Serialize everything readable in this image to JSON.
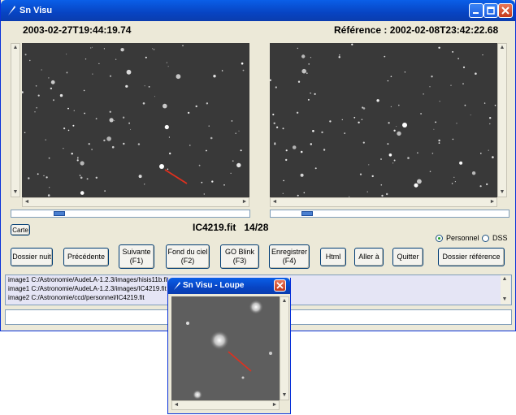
{
  "window": {
    "title": "Sn Visu"
  },
  "header": {
    "image_datetime": "2003-02-27T19:44:19.74",
    "reference_datetime": "Référence : 2002-02-08T23:42:22.68"
  },
  "center": {
    "filename": "IC4219.fit",
    "counter": "14/28"
  },
  "carte_label": "Carte",
  "radio": {
    "personnel": "Personnel",
    "dss": "DSS",
    "selected": "personnel"
  },
  "buttons": {
    "dossier_nuit": "Dossier nuit",
    "precedente": "Précédente",
    "suivante": "Suivante\n(F1)",
    "fond_du_ciel": "Fond du ciel\n(F2)",
    "go_blink": "GO Blink\n(F3)",
    "enregistrer": "Enregistrer\n(F4)",
    "html": "Html",
    "aller_a": "Aller à",
    "quitter": "Quitter",
    "dossier_reference": "Dossier référence"
  },
  "log": [
    "image1 C:/Astronomie/AudeLA-1.2.3/images/hisis11b.fit",
    "image1 C:/Astronomie/AudeLA-1.2.3/images/IC4219.fit",
    "image2 C:/Astronomie/ccd/personnel/IC4219.fit"
  ],
  "loupe": {
    "title": "Sn Visu - Loupe"
  },
  "colors": {
    "marker": "#e0301e",
    "titlebar": "#0a5fe8",
    "log_bg": "#e5e5f5"
  }
}
